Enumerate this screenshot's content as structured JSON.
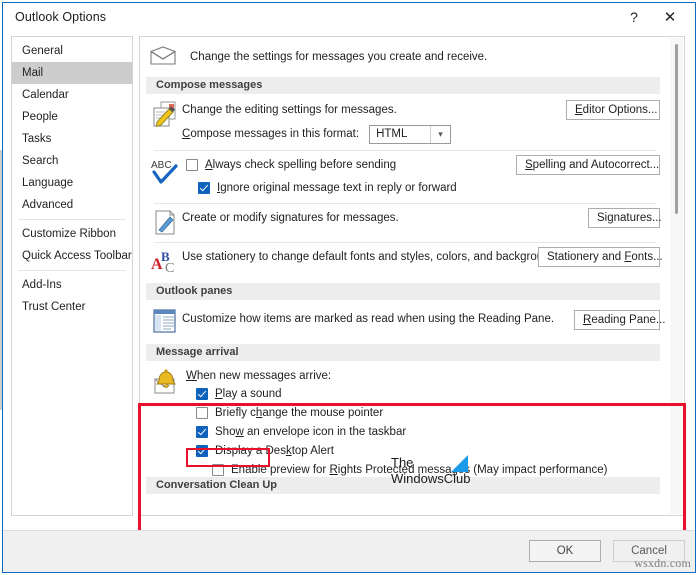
{
  "window": {
    "title": "Outlook Options",
    "help_icon": "question-mark-icon",
    "close_icon": "close-icon"
  },
  "sidebar": {
    "items": [
      {
        "label": "General",
        "selected": false
      },
      {
        "label": "Mail",
        "selected": true
      },
      {
        "label": "Calendar",
        "selected": false
      },
      {
        "label": "People",
        "selected": false
      },
      {
        "label": "Tasks",
        "selected": false
      },
      {
        "label": "Search",
        "selected": false
      },
      {
        "label": "Language",
        "selected": false
      },
      {
        "label": "Advanced",
        "selected": false
      },
      {
        "label": "Customize Ribbon",
        "selected": false
      },
      {
        "label": "Quick Access Toolbar",
        "selected": false
      },
      {
        "label": "Add-Ins",
        "selected": false
      },
      {
        "label": "Trust Center",
        "selected": false
      }
    ]
  },
  "content": {
    "intro": "Change the settings for messages you create and receive.",
    "intro_icon": "envelope-icon",
    "groups": {
      "compose": {
        "header": "Compose messages",
        "editing_text": "Change the editing settings for messages.",
        "editor_options_button": "Editor Options...",
        "format_label": "Compose messages in this format:",
        "format_value": "HTML",
        "spell_check_label": "Always check spelling before sending",
        "spell_check_checked": false,
        "ignore_original_label": "Ignore original message text in reply or forward",
        "ignore_original_checked": true,
        "spelling_button": "Spelling and Autocorrect...",
        "signatures_text": "Create or modify signatures for messages.",
        "signatures_button": "Signatures...",
        "stationery_text": "Use stationery to change default fonts and styles, colors, and backgrounds.",
        "stationery_button": "Stationery and Fonts..."
      },
      "panes": {
        "header": "Outlook panes",
        "reading_pane_text": "Customize how items are marked as read when using the Reading Pane.",
        "reading_pane_button": "Reading Pane..."
      },
      "arrival": {
        "header": "Message arrival",
        "icon": "bell-envelope-icon",
        "when_label": "When new messages arrive:",
        "options": [
          {
            "label": "Play a sound",
            "checked": true,
            "highlighted": true
          },
          {
            "label": "Briefly change the mouse pointer",
            "checked": false,
            "highlighted": false
          },
          {
            "label": "Show an envelope icon in the taskbar",
            "checked": true,
            "highlighted": false
          },
          {
            "label": "Display a Desktop Alert",
            "checked": true,
            "highlighted": false
          }
        ],
        "sub_option": {
          "label": "Enable preview for Rights Protected messages (May impact performance)",
          "checked": false
        }
      },
      "cleanup": {
        "header": "Conversation Clean Up"
      }
    }
  },
  "logo": {
    "line1": "The",
    "line2": "WindowsClub",
    "mark_color": "#1a9ae8"
  },
  "footer": {
    "ok_label": "OK",
    "cancel_label": "Cancel",
    "watermark": "wsxdn.com"
  },
  "annotation": {
    "color": "#e8112d"
  }
}
